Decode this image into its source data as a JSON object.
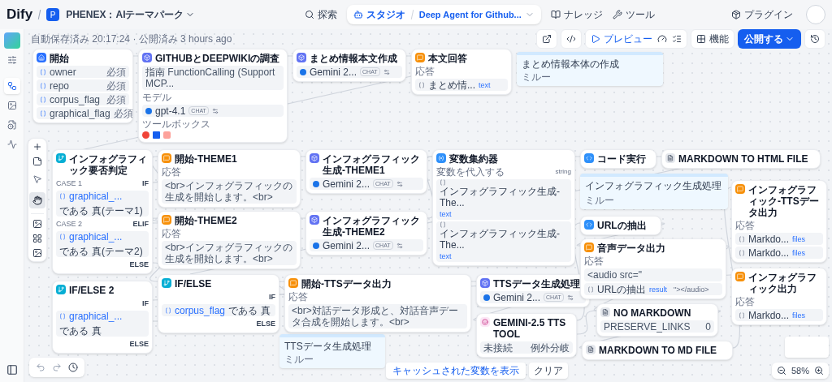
{
  "header": {
    "logo": "Dify",
    "workspace_initial": "P",
    "workspace": "PHENEX：AIテーマパーク",
    "app_name": "Deep Agent for Github...",
    "plugins": "プラグイン",
    "nav": [
      {
        "label": "探索",
        "selected": false
      },
      {
        "label": "スタジオ",
        "selected": true
      },
      {
        "label": "ナレッジ",
        "selected": false
      },
      {
        "label": "ツール",
        "selected": false
      }
    ]
  },
  "toolbar": {
    "status": "自動保存済み 20:17:24 · 公開済み 3 hours ago",
    "preview": "プレビュー",
    "features": "機能",
    "publish": "公開する"
  },
  "sidebar": {
    "items": [
      {
        "selected": true
      },
      {
        "selected": false
      },
      {
        "selected": false
      },
      {
        "selected": false
      }
    ]
  },
  "canvas_tools": {
    "modes": [
      {
        "selected": false
      },
      {
        "selected": true
      }
    ]
  },
  "nodes": [
    {
      "kind": "start",
      "title": "開始",
      "rows": [
        {
          "kind": "var",
          "text": "owner",
          "badge": "必須"
        },
        {
          "kind": "var",
          "text": "repo",
          "badge": "必須"
        },
        {
          "kind": "var",
          "text": "corpus_flag",
          "badge": "必須"
        },
        {
          "kind": "var",
          "text": "graphical_flag",
          "badge": "必須"
        }
      ]
    },
    {
      "kind": "llm",
      "title": "GITHUBとDEEPWIKIの調査",
      "rows": [
        {
          "kind": "body",
          "text": "指南 FunctionCalling (Support MCP..."
        },
        {
          "kind": "heading",
          "text": "モデル"
        },
        {
          "kind": "model",
          "text": "gpt-4.1",
          "badge": "CHAT"
        },
        {
          "kind": "heading",
          "text": "ツールボックス"
        },
        {
          "kind": "tools"
        }
      ]
    },
    {
      "kind": "llm",
      "title": "まとめ情報本文作成",
      "rows": [
        {
          "kind": "model",
          "text": "Gemini 2...",
          "badge": "CHAT"
        }
      ]
    },
    {
      "kind": "answer",
      "title": "本文回答",
      "rows": [
        {
          "kind": "heading",
          "text": "応答"
        },
        {
          "kind": "ref",
          "text": "まとめ情...",
          "badge": "text"
        }
      ]
    },
    {
      "kind": "ifelse",
      "title": "インフォグラフィック要否判定",
      "rows": [
        {
          "kind": "case",
          "label": "CASE 1",
          "text": "IF"
        },
        {
          "kind": "cond",
          "var": "graphical_...",
          "op": "である",
          "value": "真(テーマ1)"
        },
        {
          "kind": "case",
          "label": "CASE 2",
          "text": "ELIF"
        },
        {
          "kind": "cond",
          "var": "graphical_...",
          "op": "である",
          "value": "真(テーマ2)"
        },
        {
          "kind": "case",
          "text": "ELSE"
        }
      ]
    },
    {
      "kind": "answer",
      "title": "開始-THEME1",
      "rows": [
        {
          "kind": "heading",
          "text": "応答"
        },
        {
          "kind": "body",
          "text": "<br>インフォグラフィックの生成を開始します。<br>"
        }
      ]
    },
    {
      "kind": "llm",
      "title": "インフォグラフィック生成-THEME1",
      "rows": [
        {
          "kind": "model",
          "text": "Gemini 2...",
          "badge": "CHAT"
        }
      ]
    },
    {
      "kind": "aggregator",
      "title": "変数集約器",
      "rows": [
        {
          "kind": "heading",
          "text": "変数を代入する",
          "badge": "string"
        },
        {
          "kind": "ref",
          "text": "インフォグラフィック生成-The...",
          "badge": "text"
        },
        {
          "kind": "ref",
          "text": "インフォグラフィック生成-The...",
          "badge": "text"
        }
      ]
    },
    {
      "kind": "code",
      "title": "コード実行"
    },
    {
      "kind": "tool",
      "title": "MARKDOWN TO HTML FILE"
    },
    {
      "kind": "answer",
      "title": "開始-THEME2",
      "rows": [
        {
          "kind": "heading",
          "text": "応答"
        },
        {
          "kind": "body",
          "text": "<br>インフォグラフィックの生成を開始します。<br>"
        }
      ]
    },
    {
      "kind": "llm",
      "title": "インフォグラフィック生成-THEME2",
      "rows": [
        {
          "kind": "model",
          "text": "Gemini 2...",
          "badge": "CHAT"
        }
      ]
    },
    {
      "kind": "ifelse",
      "title": "IF/ELSE",
      "rows": [
        {
          "kind": "case",
          "text": "IF"
        },
        {
          "kind": "cond",
          "var": "corpus_flag",
          "op": "である",
          "value": "真"
        },
        {
          "kind": "case",
          "text": "ELSE"
        }
      ]
    },
    {
      "kind": "answer",
      "title": "開始-TTSデータ出力",
      "rows": [
        {
          "kind": "heading",
          "text": "応答"
        },
        {
          "kind": "body",
          "text": "<br>対話データ形成と、対話音声データ合成を開始します。<br>"
        }
      ]
    },
    {
      "kind": "llm",
      "title": "TTSデータ生成処理",
      "rows": [
        {
          "kind": "model",
          "text": "Gemini 2...",
          "badge": "CHAT"
        }
      ]
    },
    {
      "kind": "tts",
      "title": "GEMINI-2.5 TTS TOOL",
      "rows": [
        {
          "kind": "pair",
          "text": "未接続",
          "value": "例外分岐"
        }
      ]
    },
    {
      "kind": "code",
      "title": "URLの抽出"
    },
    {
      "kind": "answer",
      "title": "音声データ出力",
      "rows": [
        {
          "kind": "heading",
          "text": "応答"
        },
        {
          "kind": "body",
          "text": "<audio src=\""
        },
        {
          "kind": "ref",
          "text": "URLの抽出",
          "badge": "result",
          "suffix": "\"></audio>"
        }
      ]
    },
    {
      "kind": "tool",
      "title": "NO MARKDOWN",
      "rows": [
        {
          "kind": "pair",
          "text": "PRESERVE_LINKS",
          "value": "0"
        }
      ]
    },
    {
      "kind": "tool",
      "title": "MARKDOWN TO MD FILE"
    },
    {
      "kind": "answer",
      "title": "インフォグラフィック-TTSデータ出力",
      "rows": [
        {
          "kind": "heading",
          "text": "応答"
        },
        {
          "kind": "ref",
          "text": "Markdo...",
          "badge": "files"
        },
        {
          "kind": "ref",
          "text": "Markdo...",
          "badge": "files"
        }
      ]
    },
    {
      "kind": "ifelse",
      "title": "IF/ELSE 2",
      "rows": [
        {
          "kind": "case",
          "text": "IF"
        },
        {
          "kind": "cond",
          "var": "graphical_...",
          "op": "である",
          "value": "真"
        },
        {
          "kind": "case",
          "text": "ELSE"
        }
      ]
    },
    {
      "kind": "answer",
      "title": "インフォグラフィック出力",
      "rows": [
        {
          "kind": "heading",
          "text": "応答"
        },
        {
          "kind": "ref",
          "text": "Markdo...",
          "badge": "files"
        }
      ]
    }
  ],
  "notes": [
    {
      "title": "まとめ情報本体の作成",
      "author": "ミルー"
    },
    {
      "title": "インフォグラフィック生成処理",
      "author": "ミルー"
    },
    {
      "title": "TTSデータ生成処理",
      "author": "ミルー"
    }
  ],
  "footer": {
    "cache_button": "キャッシュされた変数を表示",
    "clear": "クリア",
    "zoom": "58%"
  }
}
